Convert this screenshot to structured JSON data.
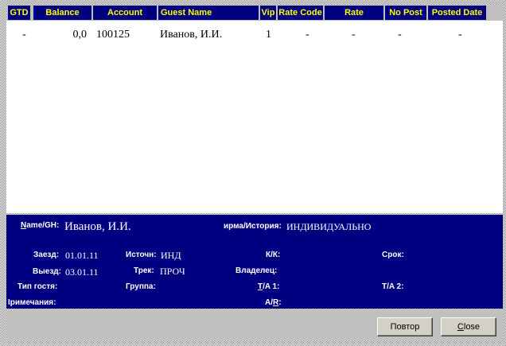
{
  "grid": {
    "columns": [
      "GTD",
      "Balance",
      "Account",
      "Guest Name",
      "Vip",
      "Rate Code",
      "Rate",
      "No Post",
      "Posted Date"
    ],
    "rows": [
      {
        "gtd": "-",
        "balance": "0,0",
        "account": "100125",
        "guest_name": "Иванов, И.И.",
        "vip": "1",
        "rate_code": "-",
        "rate": "-",
        "no_post": "-",
        "posted_date": "-"
      }
    ]
  },
  "details": {
    "name_label": "Name/GH:",
    "name_value": "Иванов, И.И.",
    "firm_label": "ирма/История:",
    "firm_value": "ИНДИВИДУАЛЬНО",
    "arrival_label": "Заезд:",
    "arrival_value": "01.01.11",
    "source_label": "Источн:",
    "source_value": "ИНД",
    "kk_label": "К/К:",
    "term_label": "Срок:",
    "departure_label": "Выезд:",
    "departure_value": "03.01.11",
    "track_label": "Трек:",
    "track_value": "ПРОЧ",
    "owner_label": "Владелец:",
    "guest_type_label": "Тип гостя:",
    "group_label": "Группа:",
    "ta1_label": "T/A 1:",
    "ta2_label": "T/A 2:",
    "notes_label": "Іримечания:",
    "ar_label": "A/R:"
  },
  "buttons": {
    "repeat": "Повтор",
    "close": "Close"
  }
}
